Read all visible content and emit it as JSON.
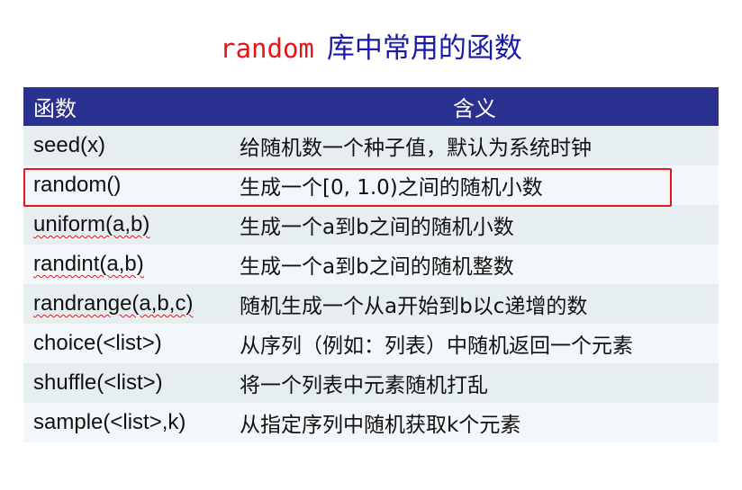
{
  "title": {
    "code": "random",
    "text": "库中常用的函数"
  },
  "table": {
    "headers": {
      "func": "函数",
      "meaning": "含义"
    },
    "rows": [
      {
        "func": "seed(x)",
        "meaning": "给随机数一个种子值，默认为系统时钟"
      },
      {
        "func": "random()",
        "meaning": "生成一个[0, 1.0)之间的随机小数"
      },
      {
        "func": "uniform(a,b)",
        "meaning": "生成一个a到b之间的随机小数"
      },
      {
        "func": "randint(a,b)",
        "meaning": "生成一个a到b之间的随机整数"
      },
      {
        "func": "randrange(a,b,c)",
        "meaning": "随机生成一个从a开始到b以c递增的数"
      },
      {
        "func": "choice(<list>)",
        "meaning": "从序列（例如：列表）中随机返回一个元素"
      },
      {
        "func": "shuffle(<list>)",
        "meaning": "将一个列表中元素随机打乱"
      },
      {
        "func": "sample(<list>,k)",
        "meaning": "从指定序列中随机获取k个元素"
      }
    ]
  },
  "highlight_color": "#e8141b"
}
